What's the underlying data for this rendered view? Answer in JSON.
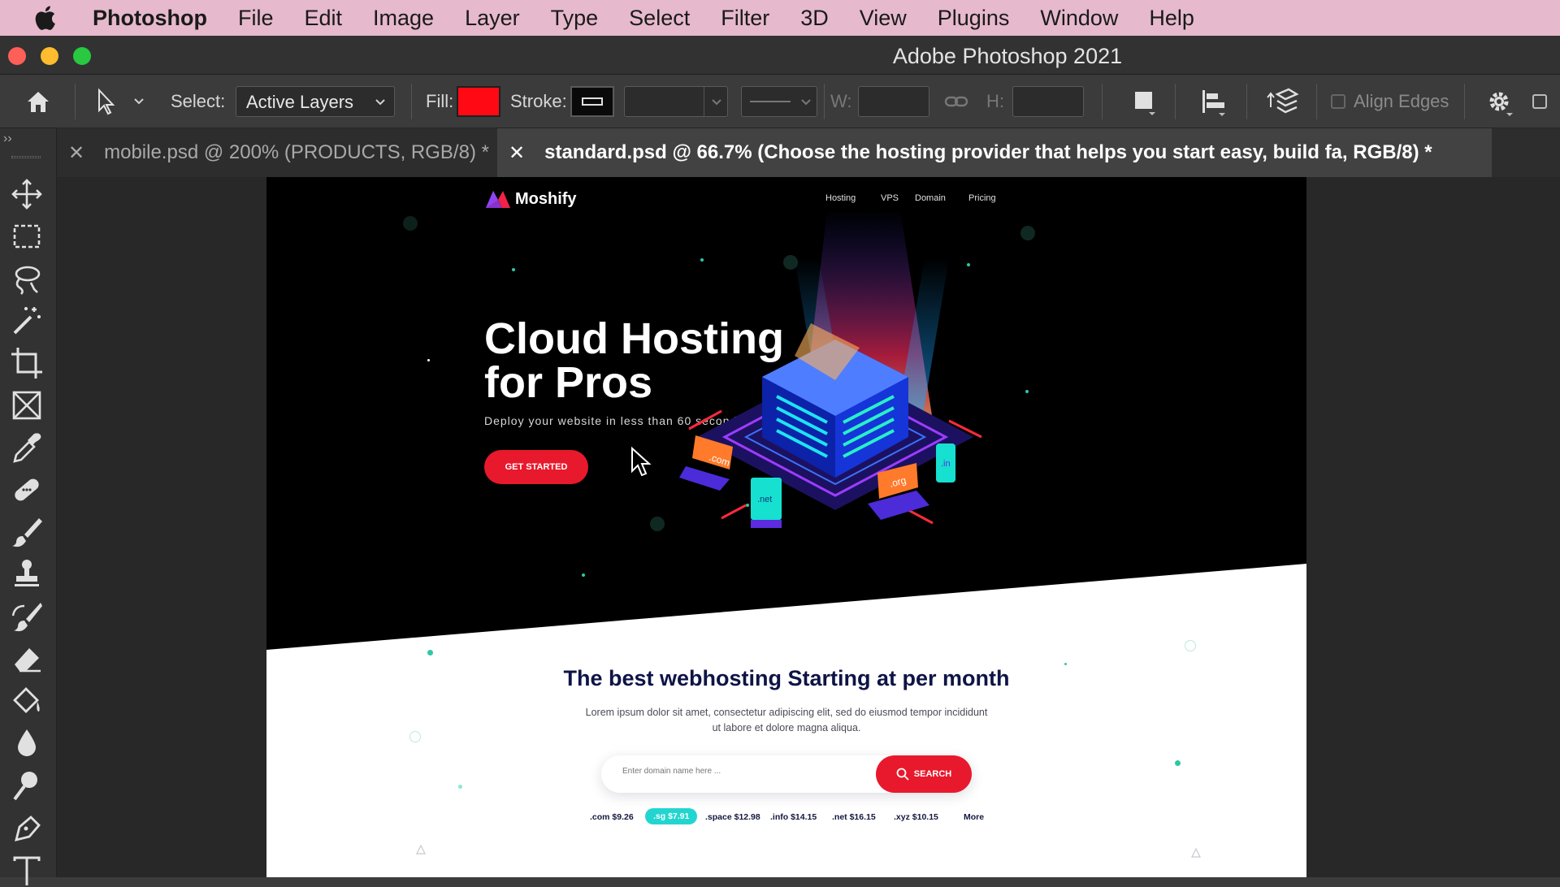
{
  "menubar": {
    "app_name": "Photoshop",
    "items": [
      "File",
      "Edit",
      "Image",
      "Layer",
      "Type",
      "Select",
      "Filter",
      "3D",
      "View",
      "Plugins",
      "Window",
      "Help"
    ]
  },
  "window": {
    "title": "Adobe Photoshop 2021"
  },
  "options": {
    "select_label": "Select:",
    "select_value": "Active Layers",
    "fill_label": "Fill:",
    "fill_color": "#ff0a14",
    "stroke_label": "Stroke:",
    "w_label": "W:",
    "h_label": "H:",
    "align_edges_label": "Align Edges"
  },
  "tabs": [
    {
      "label": "mobile.psd @ 200% (PRODUCTS, RGB/8) *",
      "active": false
    },
    {
      "label": "standard.psd @ 66.7% (Choose the hosting provider that helps you start easy, build fa, RGB/8) *",
      "active": true
    }
  ],
  "tools": [
    "move-tool-icon",
    "marquee-tool-icon",
    "lasso-tool-icon",
    "magic-wand-icon",
    "crop-tool-icon",
    "frame-tool-icon",
    "eyedropper-icon",
    "healing-brush-icon",
    "brush-tool-icon",
    "stamp-tool-icon",
    "history-brush-icon",
    "eraser-icon",
    "paint-bucket-icon",
    "blur-tool-icon",
    "dodge-tool-icon",
    "pen-tool-icon",
    "type-tool-icon"
  ],
  "document": {
    "brand": "Moshify",
    "nav": [
      "Hosting",
      "VPS",
      "Domain",
      "Pricing"
    ],
    "hero_title": "Cloud Hosting for Pros",
    "hero_subtitle": "Deploy your website in less than 60 seconds.",
    "hero_cta": "GET STARTED",
    "illustration_labels": [
      ".com",
      ".net",
      ".org",
      ".in"
    ],
    "section_title": "The best webhosting Starting at per month",
    "section_desc": "Lorem ipsum dolor sit amet, consectetur adipiscing elit, sed do eiusmod tempor incididunt ut labore et dolore magna aliqua.",
    "search_placeholder": "Enter domain name here ...",
    "search_button": "SEARCH",
    "tlds": [
      ".com $9.26",
      ".sg $7.91",
      ".space $12.98",
      ".info $14.15",
      ".net $16.15",
      ".xyz $10.15",
      "More"
    ],
    "brand_red": "#e8192c",
    "brand_navy": "#0e1446",
    "accent_teal": "#22d6cf"
  }
}
